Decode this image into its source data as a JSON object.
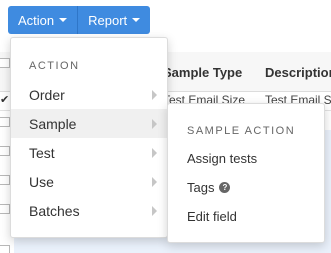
{
  "toolbar": {
    "action_label": "Action",
    "report_label": "Report"
  },
  "table": {
    "headers": [
      "Sample Type",
      "Description"
    ],
    "rows": [
      [
        "Test Email Size",
        "Test Email S"
      ]
    ]
  },
  "action_menu": {
    "header": "ACTION",
    "items": [
      {
        "label": "Order"
      },
      {
        "label": "Sample"
      },
      {
        "label": "Test"
      },
      {
        "label": "Use"
      },
      {
        "label": "Batches"
      }
    ]
  },
  "sample_submenu": {
    "header": "SAMPLE ACTION",
    "items": [
      {
        "label": "Assign tests"
      },
      {
        "label": "Tags"
      },
      {
        "label": "Edit field"
      }
    ]
  },
  "colors": {
    "button": "#3f8be0",
    "selection": "#eaf1fb",
    "menu_active": "#f0f0f0"
  }
}
